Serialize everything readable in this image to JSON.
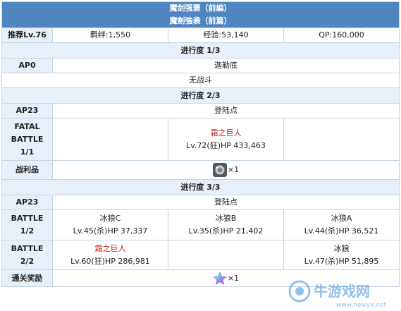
{
  "header": {
    "title_main": "魔剑强褒（前編）",
    "title_sub": "魔劍強袭（前篇）"
  },
  "summary": {
    "level": "推荐Lv.76",
    "bond": "羁绊:1,550",
    "exp": "经验:53,140",
    "qp": "QP:160,000"
  },
  "progress_1": {
    "title": "进行度 1/3",
    "ap_label": "AP0",
    "location": "迦勒底",
    "note": "无战斗"
  },
  "progress_2": {
    "title": "进行度 2/3",
    "ap_label": "AP23",
    "location": "登陆点",
    "battle_label_1": "FATAL",
    "battle_label_2": "BATTLE",
    "battle_label_3": "1/1",
    "enemy_name": "霜之巨人",
    "enemy_stats": "Lv.72(狂)HP 433,463",
    "loot_label": "战利品",
    "loot_count": "×1"
  },
  "progress_3": {
    "title": "进行度 3/3",
    "ap_label": "AP23",
    "location": "登陆点",
    "battle1_label_a": "BATTLE",
    "battle1_label_b": "1/2",
    "battle1_enemies": [
      {
        "name": "冰狼C",
        "stats": "Lv.45(杀)HP 37,337"
      },
      {
        "name": "冰狼B",
        "stats": "Lv.35(杀)HP 21,402"
      },
      {
        "name": "冰狼A",
        "stats": "Lv.44(杀)HP 36,521"
      }
    ],
    "battle2_label_a": "BATTLE",
    "battle2_label_b": "2/2",
    "battle2_enemy1": {
      "name": "霜之巨人",
      "stats": "Lv.60(狂)HP 286,981"
    },
    "battle2_enemy3": {
      "name": "冰狼",
      "stats": "Lv.47(杀)HP 51,895"
    },
    "reward_label": "通关奖励",
    "reward_count": "×1"
  },
  "watermark": {
    "brand": "牛游戏网",
    "url": "www.newyx.net"
  },
  "colors": {
    "header_bg": "#4f86c2",
    "section_bg": "#e7eff8",
    "border": "#c5d4e3",
    "enemy_red": "#cc1b1b"
  },
  "icons": {
    "loot": "grey-gem-item-icon",
    "reward": "rainbow-star-quartz-icon"
  }
}
